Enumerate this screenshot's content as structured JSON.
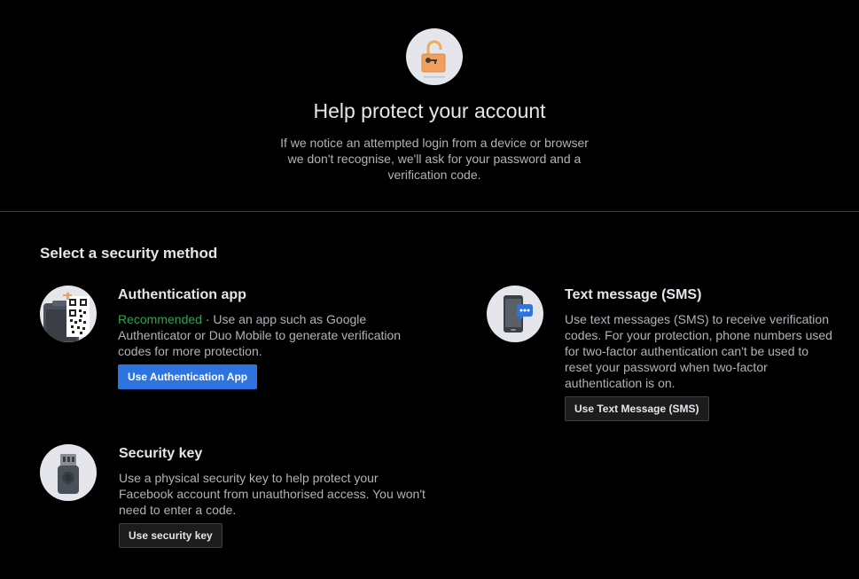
{
  "header": {
    "icon": "unlocked-padlock-icon",
    "title": "Help protect your account",
    "description": "If we notice an attempted login from a device or browser we don't recognise, we'll ask for your password and a verification code."
  },
  "section": {
    "title": "Select a security method"
  },
  "methods": {
    "auth_app": {
      "icon": "authentication-app-qr-icon",
      "title": "Authentication app",
      "recommended": "Recommended",
      "description": " · Use an app such as Google Authenticator or Duo Mobile to generate verification codes for more protection.",
      "button": "Use Authentication App"
    },
    "sms": {
      "icon": "phone-message-icon",
      "title": "Text message (SMS)",
      "description": "Use text messages (SMS) to receive verification codes. For your protection, phone numbers used for two-factor authentication can't be used to reset your password when two-factor authentication is on.",
      "button": "Use Text Message (SMS)"
    },
    "security_key": {
      "icon": "usb-security-key-icon",
      "title": "Security key",
      "description": "Use a physical security key to help protect your Facebook account from unauthorised access. You won't need to enter a code.",
      "button": "Use security key"
    }
  },
  "colors": {
    "background": "#000000",
    "primary_button": "#2d74e0",
    "recommended": "#31a24c",
    "divider": "#3a3b3c"
  }
}
